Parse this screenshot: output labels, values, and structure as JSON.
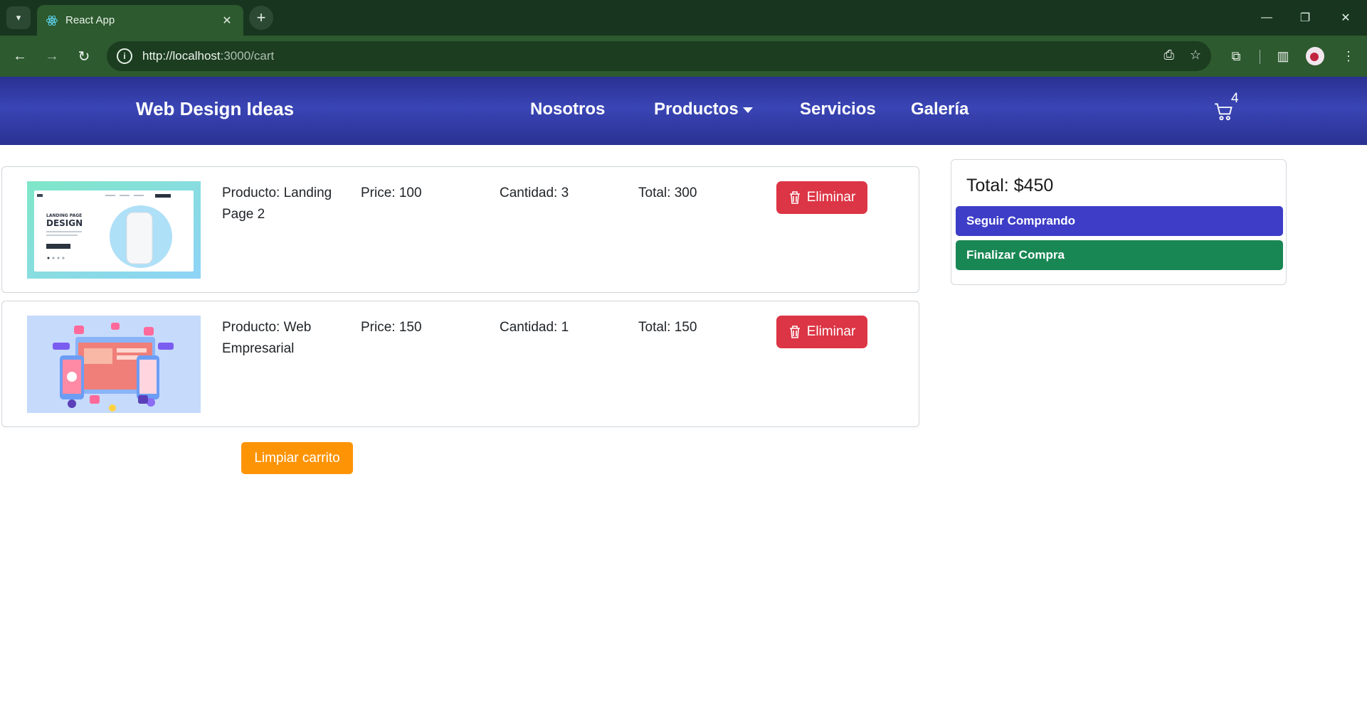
{
  "browser": {
    "tab_title": "React App",
    "url_host": "http://localhost",
    "url_rest": ":3000/cart"
  },
  "navbar": {
    "brand": "Web Design Ideas",
    "links": [
      "Nosotros",
      "Productos",
      "Servicios",
      "Galería"
    ],
    "cart_count": "4"
  },
  "cart": {
    "items": [
      {
        "product": "Producto: Landing Page 2",
        "price": "Price: 100",
        "quantity": "Cantidad: 3",
        "total": "Total: 300",
        "remove_label": "Eliminar"
      },
      {
        "product": "Producto: Web Empresarial",
        "price": "Price: 150",
        "quantity": "Cantidad: 1",
        "total": "Total: 150",
        "remove_label": "Eliminar"
      }
    ],
    "clear_label": "Limpiar carrito"
  },
  "summary": {
    "total": "Total: $450",
    "continue_label": "Seguir Comprando",
    "checkout_label": "Finalizar Compra"
  },
  "colors": {
    "navbar": "#2a3192",
    "danger": "#dc3545",
    "continue": "#3d3dc8",
    "checkout": "#198754",
    "clear": "#fd9406"
  },
  "thumbnail_text": {
    "landing_heading_small": "LANDING PAGE",
    "landing_heading_big": "DESIGN"
  }
}
